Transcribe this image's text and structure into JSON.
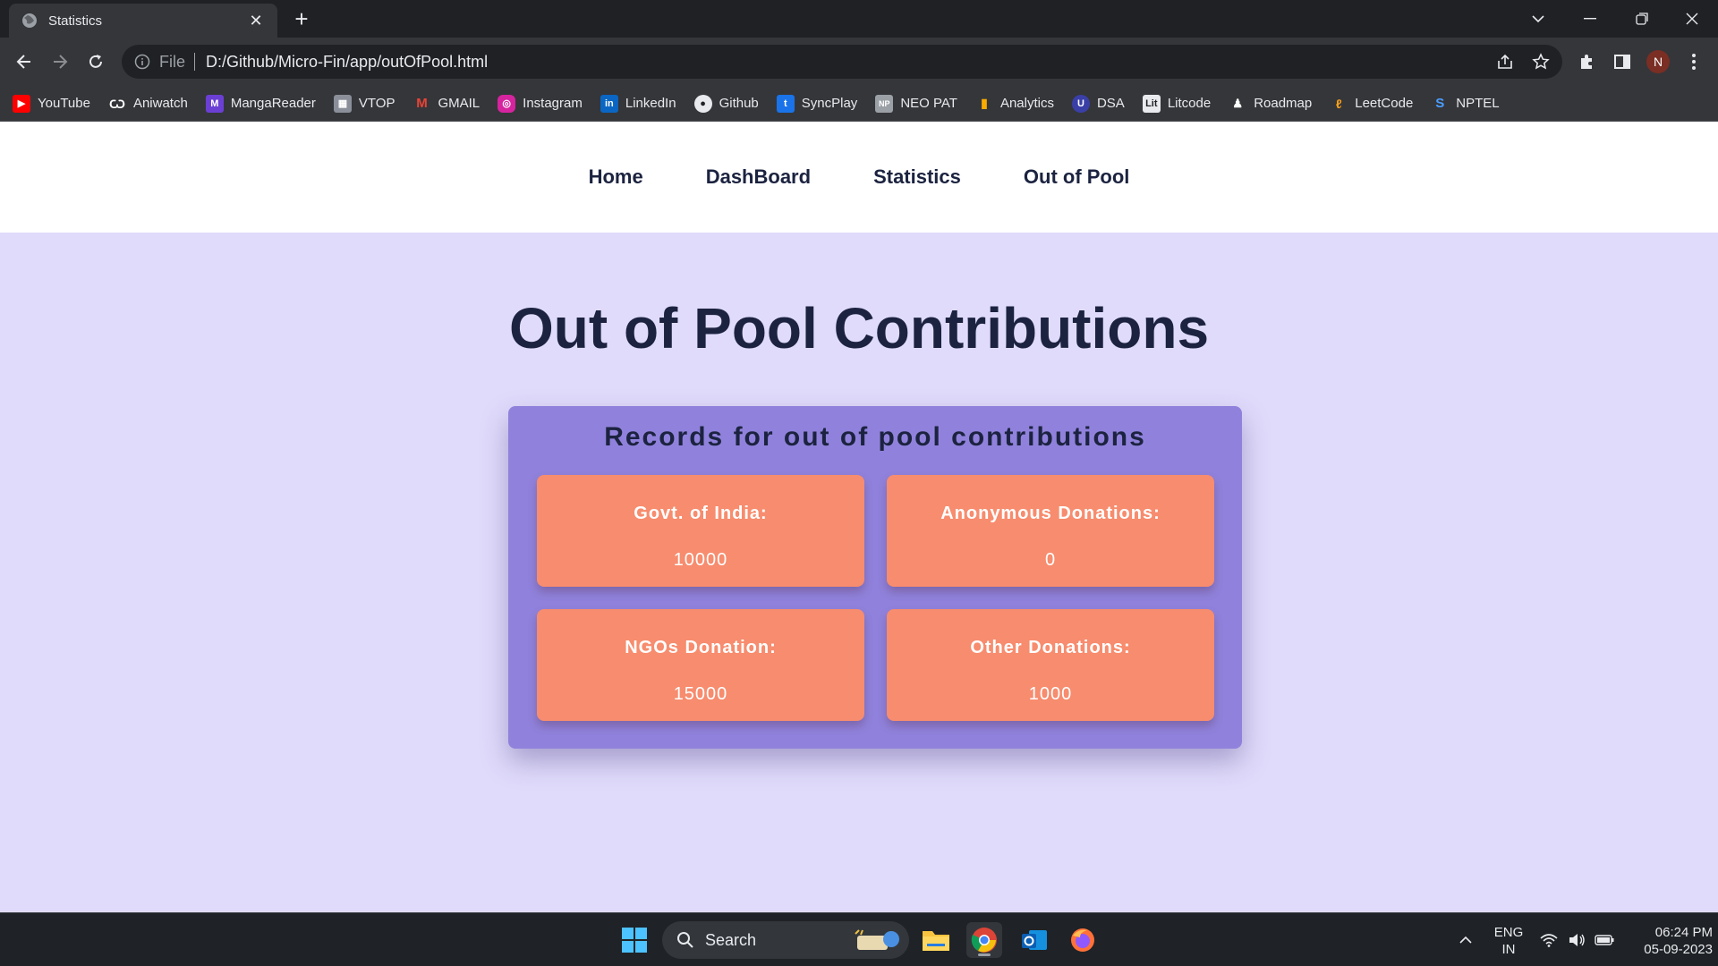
{
  "browser": {
    "tab_title": "Statistics",
    "url_scheme": "File",
    "url": "D:/Github/Micro-Fin/app/outOfPool.html",
    "avatar_letter": "N"
  },
  "bookmarks": [
    {
      "label": "YouTube",
      "icon": "youtube-icon",
      "color": "#ff0000"
    },
    {
      "label": "Aniwatch",
      "icon": "aniwatch-icon",
      "color": "#35363a"
    },
    {
      "label": "MangaReader",
      "icon": "mangareader-icon",
      "color": "#6b3fd4"
    },
    {
      "label": "VTOP",
      "icon": "vtop-icon",
      "color": "#8a8f99"
    },
    {
      "label": "GMAIL",
      "icon": "gmail-icon",
      "color": "#35363a"
    },
    {
      "label": "Instagram",
      "icon": "instagram-icon",
      "color": "#d6249f"
    },
    {
      "label": "LinkedIn",
      "icon": "linkedin-icon",
      "color": "#0a66c2"
    },
    {
      "label": "Github",
      "icon": "github-icon",
      "color": "#35363a"
    },
    {
      "label": "SyncPlay",
      "icon": "syncplay-icon",
      "color": "#1a73e8"
    },
    {
      "label": "NEO PAT",
      "icon": "neopat-icon",
      "color": "#9aa0a6"
    },
    {
      "label": "Analytics",
      "icon": "analytics-icon",
      "color": "#f9ab00"
    },
    {
      "label": "DSA",
      "icon": "dsa-icon",
      "color": "#3a3fa8"
    },
    {
      "label": "Litcode",
      "icon": "litcode-icon",
      "color": "#e8eaed"
    },
    {
      "label": "Roadmap",
      "icon": "roadmap-icon",
      "color": "#35363a"
    },
    {
      "label": "LeetCode",
      "icon": "leetcode-icon",
      "color": "#35363a"
    },
    {
      "label": "NPTEL",
      "icon": "nptel-icon",
      "color": "#1a73e8"
    }
  ],
  "nav": {
    "items": [
      "Home",
      "DashBoard",
      "Statistics",
      "Out of Pool"
    ]
  },
  "page": {
    "title": "Out of Pool Contributions"
  },
  "records": {
    "title": "Records for out of pool contributions",
    "stats": [
      {
        "label": "Govt. of India:",
        "value": "10000"
      },
      {
        "label": "Anonymous Donations:",
        "value": "0"
      },
      {
        "label": "NGOs Donation:",
        "value": "15000"
      },
      {
        "label": "Other Donations:",
        "value": "1000"
      }
    ]
  },
  "taskbar": {
    "search_label": "Search",
    "lang_line1": "ENG",
    "lang_line2": "IN",
    "time": "06:24 PM",
    "date": "05-09-2023"
  },
  "colors": {
    "page_bg": "#e0dbfb",
    "card_bg": "#9082dc",
    "stat_bg": "#f78c6e",
    "heading": "#1c2340"
  }
}
